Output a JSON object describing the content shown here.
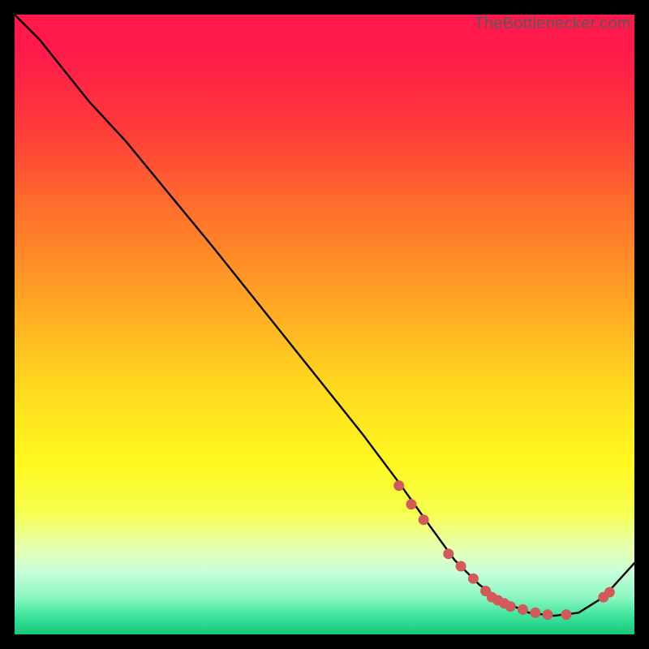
{
  "watermark": "TheBottlenecker.com",
  "colors": {
    "gradient_stops": [
      {
        "offset": 0.0,
        "color": "#ff1a4b"
      },
      {
        "offset": 0.06,
        "color": "#ff1a4b"
      },
      {
        "offset": 0.18,
        "color": "#ff3a3a"
      },
      {
        "offset": 0.3,
        "color": "#ff6a2d"
      },
      {
        "offset": 0.45,
        "color": "#ffa125"
      },
      {
        "offset": 0.6,
        "color": "#ffd91f"
      },
      {
        "offset": 0.72,
        "color": "#fff81f"
      },
      {
        "offset": 0.8,
        "color": "#f6ff4a"
      },
      {
        "offset": 0.86,
        "color": "#e8ffb0"
      },
      {
        "offset": 0.9,
        "color": "#c6ffd9"
      },
      {
        "offset": 0.94,
        "color": "#8cf7c1"
      },
      {
        "offset": 0.97,
        "color": "#3de49e"
      },
      {
        "offset": 1.0,
        "color": "#18c777"
      }
    ],
    "line": "#000000",
    "marker": "#d15a5a"
  },
  "chart_data": {
    "type": "line",
    "title": "",
    "xlabel": "",
    "ylabel": "",
    "xlim": [
      0,
      100
    ],
    "ylim": [
      0,
      100
    ],
    "series": [
      {
        "name": "curve",
        "x": [
          0,
          4,
          8,
          12,
          18,
          25,
          32,
          40,
          48,
          56,
          62,
          67,
          71,
          75,
          79,
          83,
          87,
          91,
          95,
          100
        ],
        "y": [
          100,
          96,
          91,
          86,
          79.5,
          71,
          62.5,
          52.5,
          42.5,
          32.5,
          24.5,
          17.5,
          12,
          8,
          5.2,
          3.5,
          3.0,
          3.5,
          6.0,
          11.5
        ]
      }
    ],
    "markers": {
      "x": [
        62,
        64,
        66,
        70,
        72,
        74,
        76,
        77,
        78,
        79,
        80,
        82,
        84,
        86,
        89,
        95,
        96
      ],
      "y": [
        24,
        21,
        18.5,
        13,
        11,
        9,
        7,
        6,
        5.5,
        5,
        4.5,
        4,
        3.5,
        3.2,
        3.2,
        6,
        6.8
      ]
    }
  }
}
